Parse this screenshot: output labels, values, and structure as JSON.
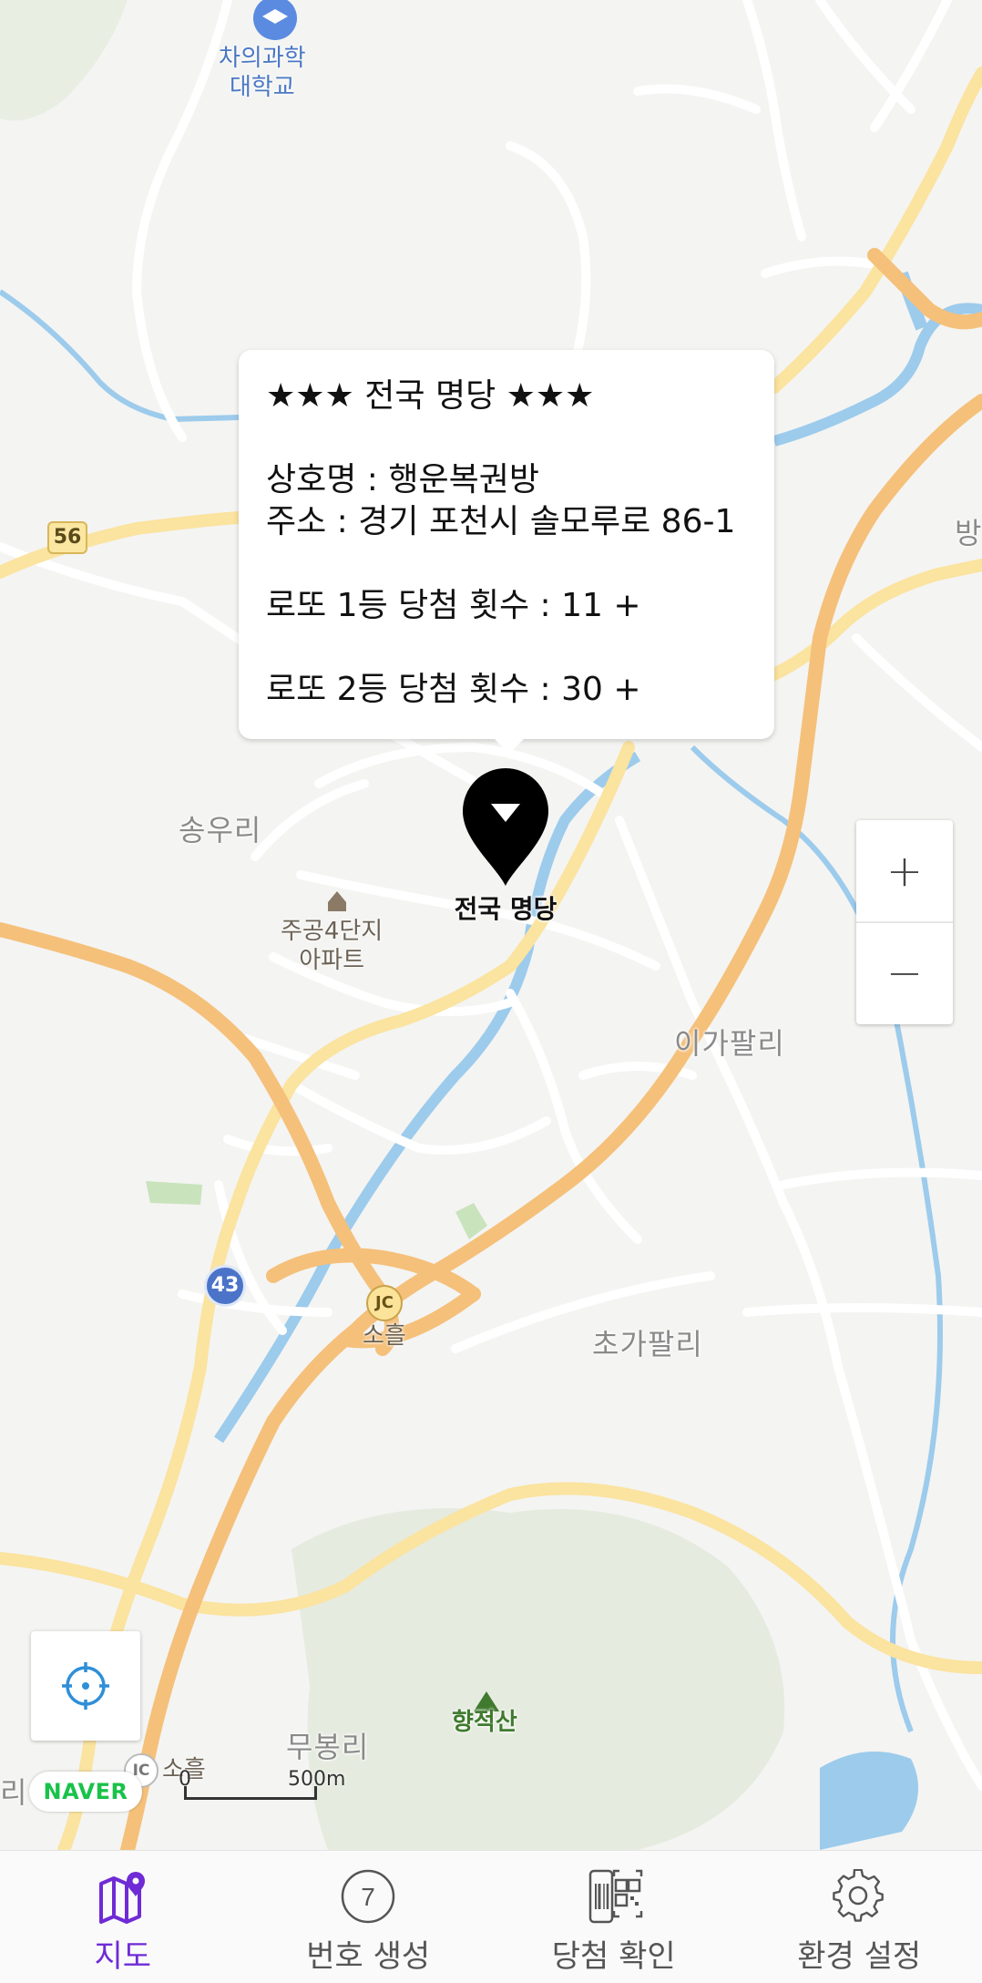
{
  "map": {
    "place_labels": {
      "songuri": "송우리",
      "igapalli": "이가팔리",
      "chogapalli": "초가팔리",
      "mubongri": "무봉리"
    },
    "pois": {
      "cha_university": "차의과학\n대학교",
      "jugong_apt": "주공4단지\n아파트",
      "hyangjeoksan": "향적산",
      "soheul_jc": "소흘",
      "soheul_ic": "소흘"
    },
    "badges": {
      "route_56": "56",
      "route_43": "43",
      "jc": "JC",
      "ic": "IC"
    },
    "edge_label_right": "방",
    "edge_label_left": "리"
  },
  "popup": {
    "title": "★★★ 전국 명당 ★★★",
    "shop_name": "상호명 : 행운복권방",
    "address": "주소 : 경기 포천시 솔모루로 86-1",
    "first_prize": "로또 1등 당첨 횟수 :  11 +",
    "second_prize": "로또 2등 당첨 횟수 :  30 +"
  },
  "marker": {
    "label": "전국 명당"
  },
  "zoom": {
    "in_label": "+",
    "out_label": "−"
  },
  "attribution": {
    "logo": "NAVER",
    "scale_zero": "0",
    "scale_distance": "500m"
  },
  "nav": {
    "map": "지도",
    "generate": "번호 생성",
    "generate_ball": "7",
    "check": "당첨 확인",
    "settings": "환경 설정"
  },
  "colors": {
    "accent": "#6f2bd6",
    "road_major": "#f5c07a",
    "road_secondary": "#fbe3a0",
    "water": "#9ccbec"
  }
}
